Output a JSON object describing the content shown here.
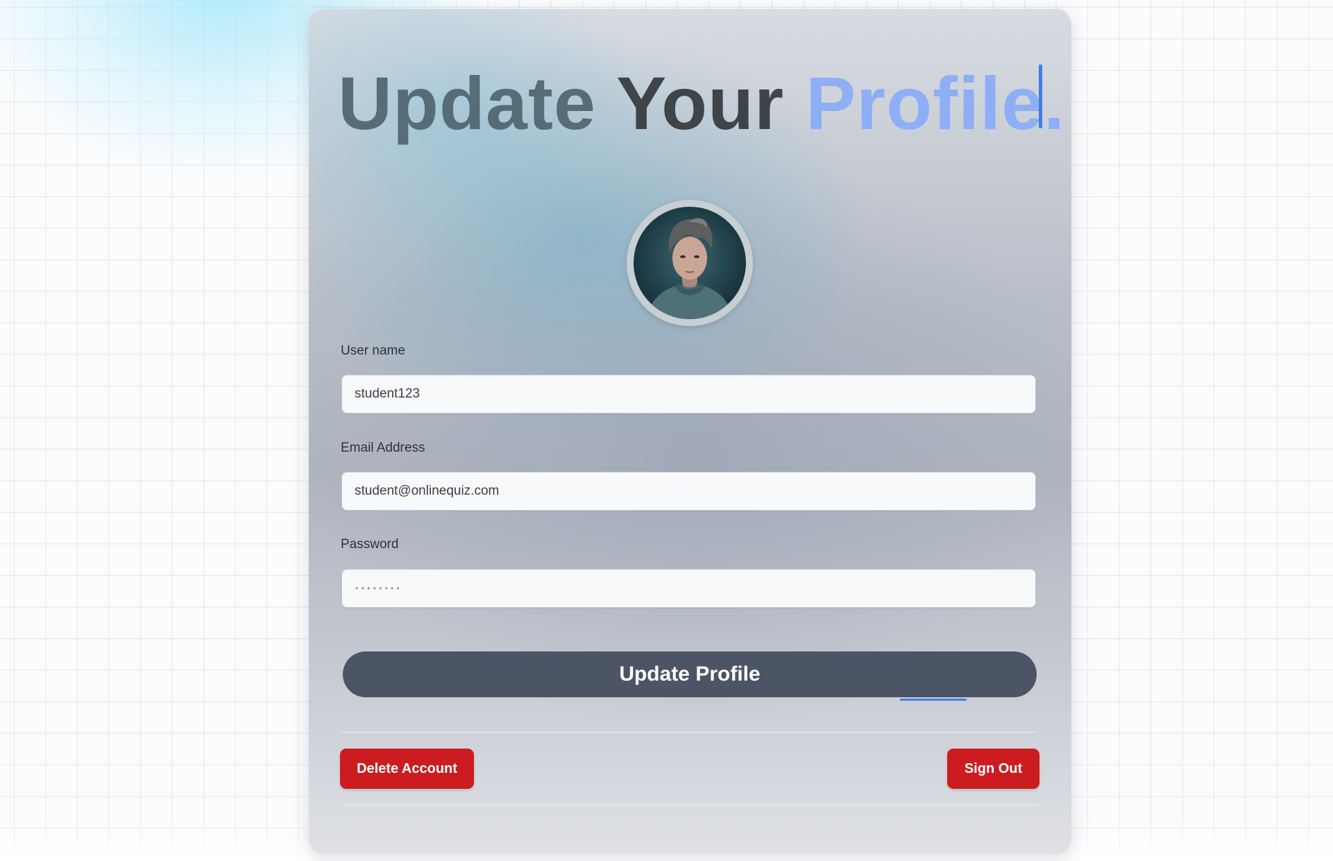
{
  "header": {
    "title_part1": "Update",
    "title_part2": "Your",
    "title_part3": "Profile."
  },
  "avatar": {
    "icon": "user-avatar-photo"
  },
  "form": {
    "username": {
      "label": "User name",
      "value": "student123"
    },
    "email": {
      "label": "Email Address",
      "value": "student@onlinequiz.com"
    },
    "password": {
      "label": "Password",
      "value": "••••••••"
    }
  },
  "actions": {
    "update_label": "Update Profile",
    "delete_label": "Delete Account",
    "signout_label": "Sign Out"
  },
  "colors": {
    "accent": "#3f7ee8",
    "title_highlight": "#8eaef5",
    "primary_button": "#4b5566",
    "danger": "#cc1c1f"
  }
}
